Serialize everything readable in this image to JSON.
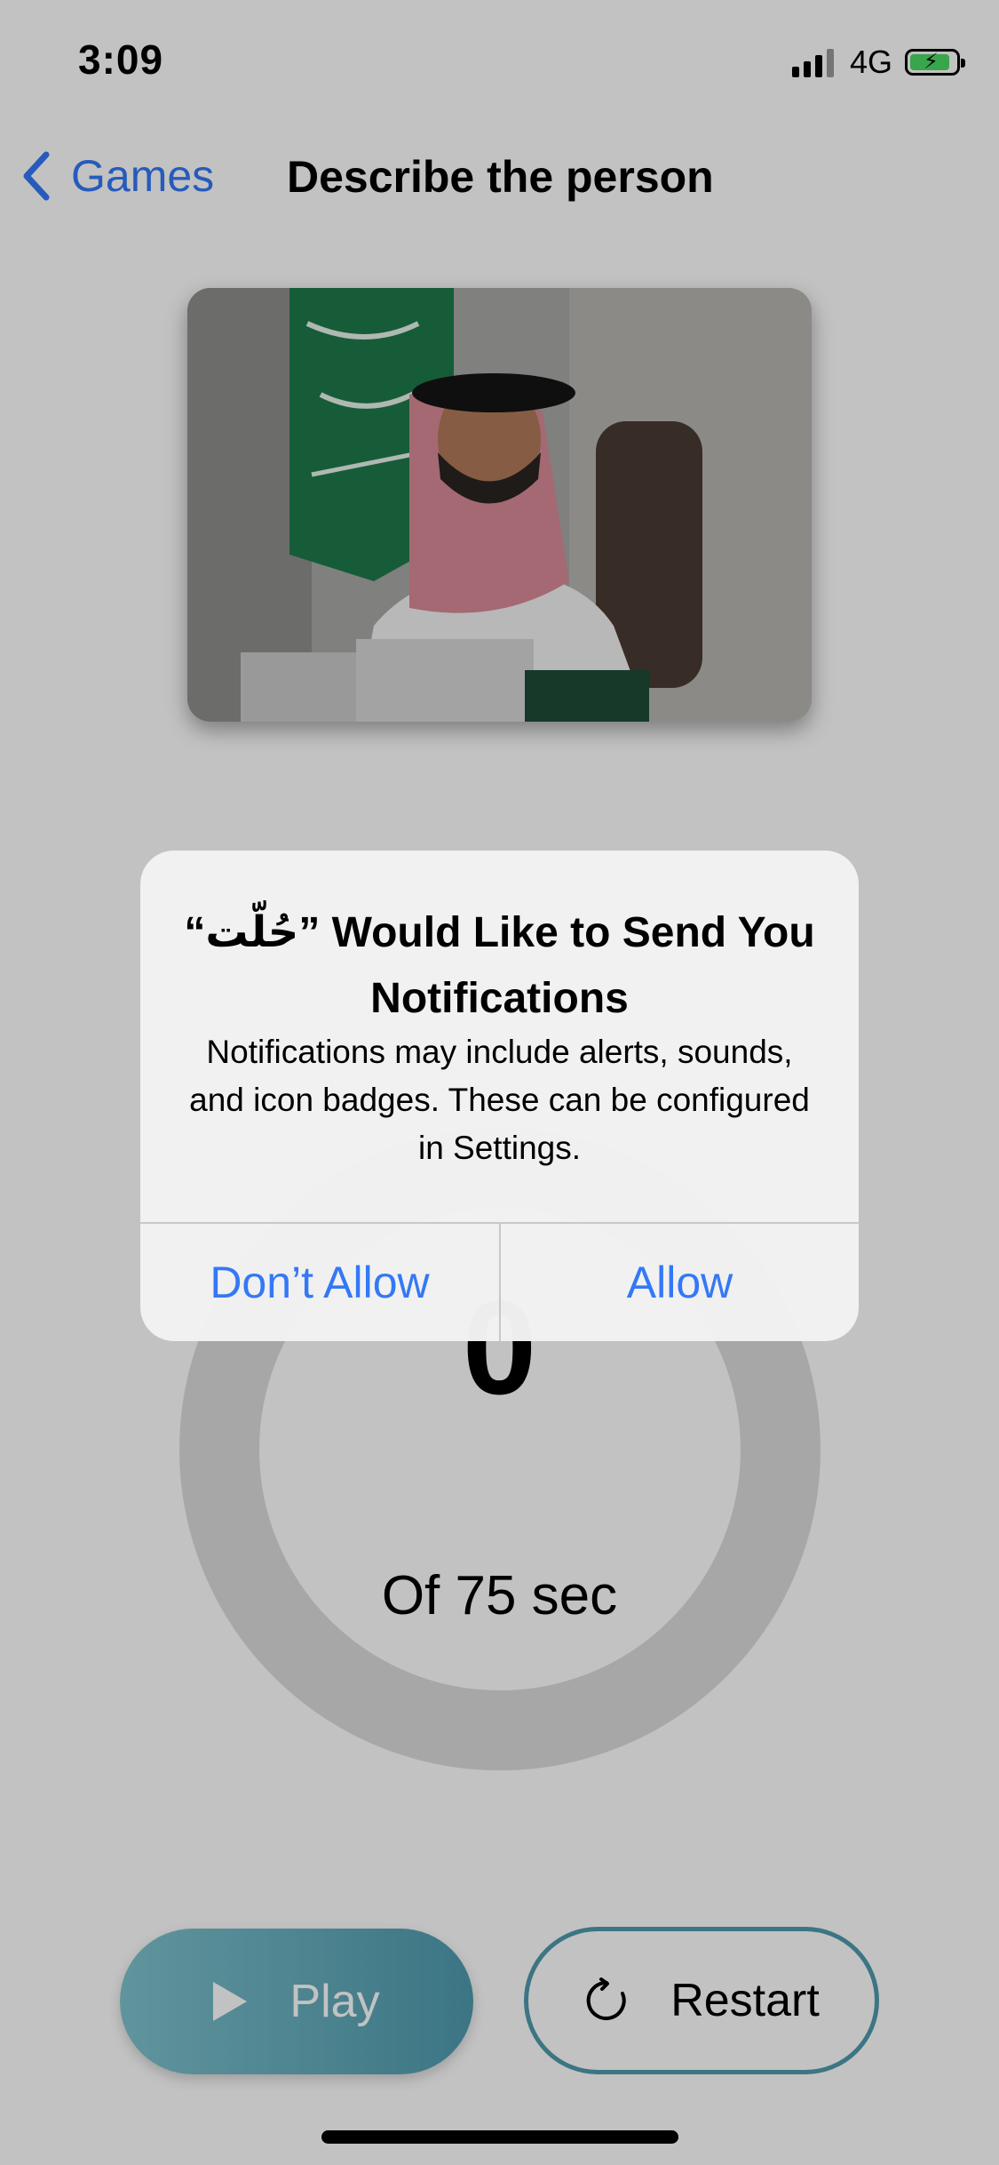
{
  "status_bar": {
    "time": "3:09",
    "network": "4G"
  },
  "nav": {
    "back_label": "Games",
    "title": "Describe the person"
  },
  "photo": {
    "icon": "person-photo"
  },
  "timer": {
    "value": "0",
    "caption": "Of 75 sec",
    "progress": 0
  },
  "buttons": {
    "play_label": "Play",
    "restart_label": "Restart"
  },
  "alert": {
    "title": "“حُلّت” Would Like to Send You Notifications",
    "message": "Notifications may include alerts, sounds, and icon badges. These can be configured in Settings.",
    "dont_allow_label": "Don’t Allow",
    "allow_label": "Allow"
  },
  "colors": {
    "accent": "#3478f6",
    "teal": "#4f9aae",
    "ring": "#dcdcdc",
    "battery": "#4cd964"
  }
}
